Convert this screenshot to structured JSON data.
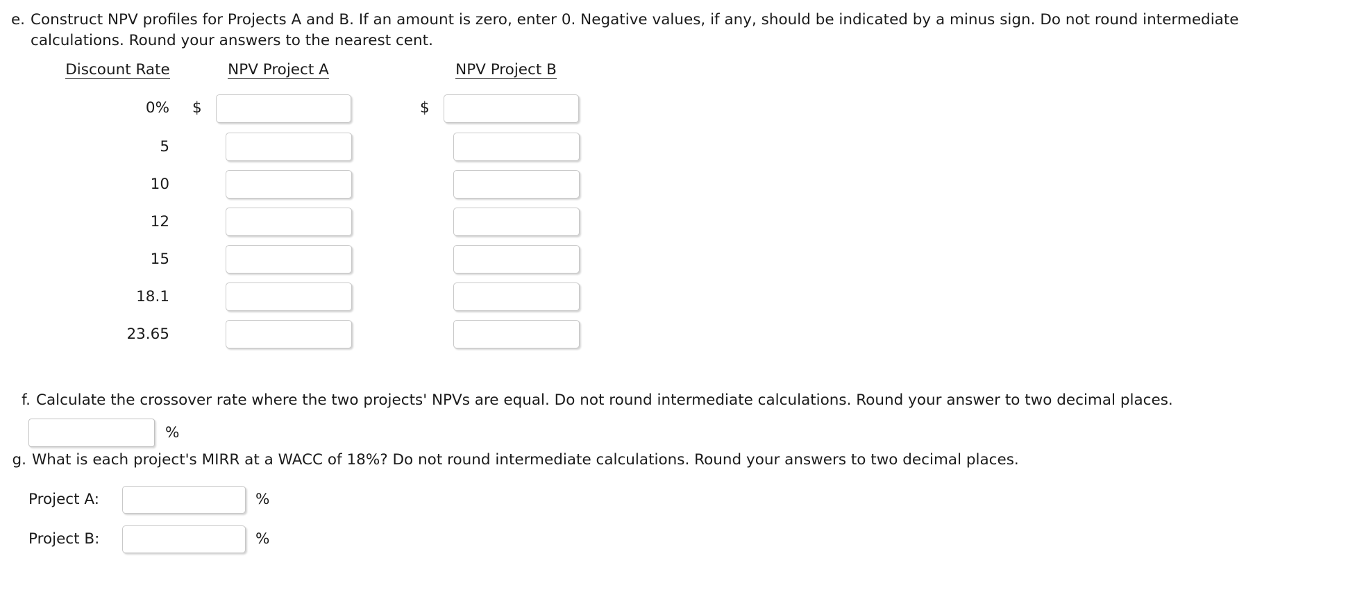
{
  "parts": {
    "e": {
      "letter": "e.",
      "prompt": "Construct NPV profiles for Projects A and B. If an amount is zero, enter 0. Negative values, if any, should be indicated by a minus sign. Do not round intermediate calculations. Round your answers to the nearest cent.",
      "table": {
        "headers": {
          "rate": "Discount Rate",
          "project_a": "NPV Project A",
          "project_b": "NPV Project B"
        },
        "currency_symbol": "$",
        "rows": [
          {
            "rate": "0%",
            "npv_a": "",
            "npv_b": "",
            "show_currency": true
          },
          {
            "rate": "5",
            "npv_a": "",
            "npv_b": "",
            "show_currency": false
          },
          {
            "rate": "10",
            "npv_a": "",
            "npv_b": "",
            "show_currency": false
          },
          {
            "rate": "12",
            "npv_a": "",
            "npv_b": "",
            "show_currency": false
          },
          {
            "rate": "15",
            "npv_a": "",
            "npv_b": "",
            "show_currency": false
          },
          {
            "rate": "18.1",
            "npv_a": "",
            "npv_b": "",
            "show_currency": false
          },
          {
            "rate": "23.65",
            "npv_a": "",
            "npv_b": "",
            "show_currency": false
          }
        ]
      }
    },
    "f": {
      "letter": "f.",
      "prompt": "Calculate the crossover rate where the two projects' NPVs are equal. Do not round intermediate calculations. Round your answer to two decimal places.",
      "answer_value": "",
      "unit": "%"
    },
    "g": {
      "letter": "g.",
      "prompt": "What is each project's MIRR at a WACC of 18%? Do not round intermediate calculations. Round your answers to two decimal places.",
      "unit": "%",
      "rows": [
        {
          "label": "Project A:",
          "value": ""
        },
        {
          "label": "Project B:",
          "value": ""
        }
      ]
    }
  },
  "colors": {
    "text": "#1b1b1b",
    "field_border": "#c9c9c9",
    "page_background": "#ffffff"
  }
}
